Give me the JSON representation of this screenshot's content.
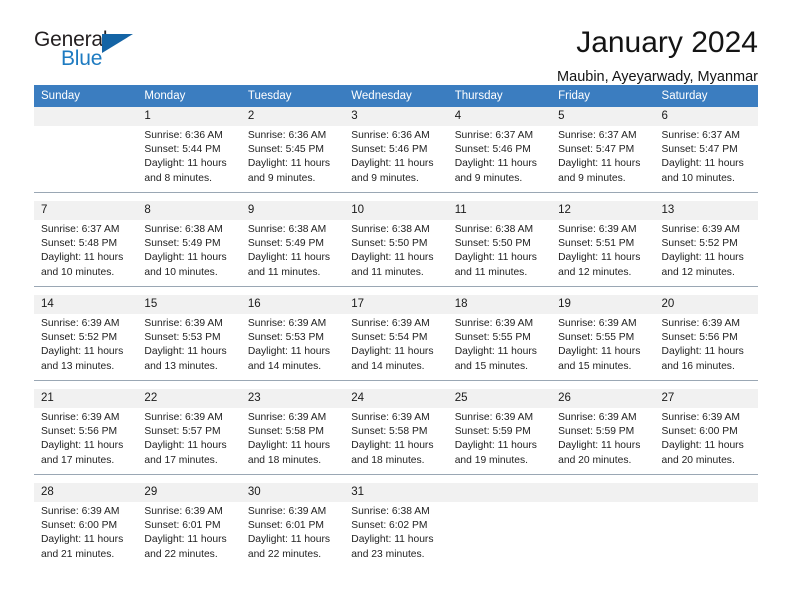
{
  "logo": {
    "word_one": "General",
    "word_two": "Blue",
    "mark": "triangle-icon"
  },
  "header": {
    "title": "January 2024",
    "location": "Maubin, Ayeyarwady, Myanmar"
  },
  "theme": {
    "header_blue": "#3b7dc0",
    "daynum_gray": "#f1f1f1",
    "separator": "#9aa7b4",
    "logo_blue": "#1e7bc1"
  },
  "calendar": {
    "weekday_headers": [
      "Sunday",
      "Monday",
      "Tuesday",
      "Wednesday",
      "Thursday",
      "Friday",
      "Saturday"
    ],
    "weeks": [
      [
        {
          "day": "",
          "sunrise": "",
          "sunset": "",
          "daylight_line1": "",
          "daylight_line2": ""
        },
        {
          "day": "1",
          "sunrise": "Sunrise: 6:36 AM",
          "sunset": "Sunset: 5:44 PM",
          "daylight_line1": "Daylight: 11 hours",
          "daylight_line2": "and 8 minutes."
        },
        {
          "day": "2",
          "sunrise": "Sunrise: 6:36 AM",
          "sunset": "Sunset: 5:45 PM",
          "daylight_line1": "Daylight: 11 hours",
          "daylight_line2": "and 9 minutes."
        },
        {
          "day": "3",
          "sunrise": "Sunrise: 6:36 AM",
          "sunset": "Sunset: 5:46 PM",
          "daylight_line1": "Daylight: 11 hours",
          "daylight_line2": "and 9 minutes."
        },
        {
          "day": "4",
          "sunrise": "Sunrise: 6:37 AM",
          "sunset": "Sunset: 5:46 PM",
          "daylight_line1": "Daylight: 11 hours",
          "daylight_line2": "and 9 minutes."
        },
        {
          "day": "5",
          "sunrise": "Sunrise: 6:37 AM",
          "sunset": "Sunset: 5:47 PM",
          "daylight_line1": "Daylight: 11 hours",
          "daylight_line2": "and 9 minutes."
        },
        {
          "day": "6",
          "sunrise": "Sunrise: 6:37 AM",
          "sunset": "Sunset: 5:47 PM",
          "daylight_line1": "Daylight: 11 hours",
          "daylight_line2": "and 10 minutes."
        }
      ],
      [
        {
          "day": "7",
          "sunrise": "Sunrise: 6:37 AM",
          "sunset": "Sunset: 5:48 PM",
          "daylight_line1": "Daylight: 11 hours",
          "daylight_line2": "and 10 minutes."
        },
        {
          "day": "8",
          "sunrise": "Sunrise: 6:38 AM",
          "sunset": "Sunset: 5:49 PM",
          "daylight_line1": "Daylight: 11 hours",
          "daylight_line2": "and 10 minutes."
        },
        {
          "day": "9",
          "sunrise": "Sunrise: 6:38 AM",
          "sunset": "Sunset: 5:49 PM",
          "daylight_line1": "Daylight: 11 hours",
          "daylight_line2": "and 11 minutes."
        },
        {
          "day": "10",
          "sunrise": "Sunrise: 6:38 AM",
          "sunset": "Sunset: 5:50 PM",
          "daylight_line1": "Daylight: 11 hours",
          "daylight_line2": "and 11 minutes."
        },
        {
          "day": "11",
          "sunrise": "Sunrise: 6:38 AM",
          "sunset": "Sunset: 5:50 PM",
          "daylight_line1": "Daylight: 11 hours",
          "daylight_line2": "and 11 minutes."
        },
        {
          "day": "12",
          "sunrise": "Sunrise: 6:39 AM",
          "sunset": "Sunset: 5:51 PM",
          "daylight_line1": "Daylight: 11 hours",
          "daylight_line2": "and 12 minutes."
        },
        {
          "day": "13",
          "sunrise": "Sunrise: 6:39 AM",
          "sunset": "Sunset: 5:52 PM",
          "daylight_line1": "Daylight: 11 hours",
          "daylight_line2": "and 12 minutes."
        }
      ],
      [
        {
          "day": "14",
          "sunrise": "Sunrise: 6:39 AM",
          "sunset": "Sunset: 5:52 PM",
          "daylight_line1": "Daylight: 11 hours",
          "daylight_line2": "and 13 minutes."
        },
        {
          "day": "15",
          "sunrise": "Sunrise: 6:39 AM",
          "sunset": "Sunset: 5:53 PM",
          "daylight_line1": "Daylight: 11 hours",
          "daylight_line2": "and 13 minutes."
        },
        {
          "day": "16",
          "sunrise": "Sunrise: 6:39 AM",
          "sunset": "Sunset: 5:53 PM",
          "daylight_line1": "Daylight: 11 hours",
          "daylight_line2": "and 14 minutes."
        },
        {
          "day": "17",
          "sunrise": "Sunrise: 6:39 AM",
          "sunset": "Sunset: 5:54 PM",
          "daylight_line1": "Daylight: 11 hours",
          "daylight_line2": "and 14 minutes."
        },
        {
          "day": "18",
          "sunrise": "Sunrise: 6:39 AM",
          "sunset": "Sunset: 5:55 PM",
          "daylight_line1": "Daylight: 11 hours",
          "daylight_line2": "and 15 minutes."
        },
        {
          "day": "19",
          "sunrise": "Sunrise: 6:39 AM",
          "sunset": "Sunset: 5:55 PM",
          "daylight_line1": "Daylight: 11 hours",
          "daylight_line2": "and 15 minutes."
        },
        {
          "day": "20",
          "sunrise": "Sunrise: 6:39 AM",
          "sunset": "Sunset: 5:56 PM",
          "daylight_line1": "Daylight: 11 hours",
          "daylight_line2": "and 16 minutes."
        }
      ],
      [
        {
          "day": "21",
          "sunrise": "Sunrise: 6:39 AM",
          "sunset": "Sunset: 5:56 PM",
          "daylight_line1": "Daylight: 11 hours",
          "daylight_line2": "and 17 minutes."
        },
        {
          "day": "22",
          "sunrise": "Sunrise: 6:39 AM",
          "sunset": "Sunset: 5:57 PM",
          "daylight_line1": "Daylight: 11 hours",
          "daylight_line2": "and 17 minutes."
        },
        {
          "day": "23",
          "sunrise": "Sunrise: 6:39 AM",
          "sunset": "Sunset: 5:58 PM",
          "daylight_line1": "Daylight: 11 hours",
          "daylight_line2": "and 18 minutes."
        },
        {
          "day": "24",
          "sunrise": "Sunrise: 6:39 AM",
          "sunset": "Sunset: 5:58 PM",
          "daylight_line1": "Daylight: 11 hours",
          "daylight_line2": "and 18 minutes."
        },
        {
          "day": "25",
          "sunrise": "Sunrise: 6:39 AM",
          "sunset": "Sunset: 5:59 PM",
          "daylight_line1": "Daylight: 11 hours",
          "daylight_line2": "and 19 minutes."
        },
        {
          "day": "26",
          "sunrise": "Sunrise: 6:39 AM",
          "sunset": "Sunset: 5:59 PM",
          "daylight_line1": "Daylight: 11 hours",
          "daylight_line2": "and 20 minutes."
        },
        {
          "day": "27",
          "sunrise": "Sunrise: 6:39 AM",
          "sunset": "Sunset: 6:00 PM",
          "daylight_line1": "Daylight: 11 hours",
          "daylight_line2": "and 20 minutes."
        }
      ],
      [
        {
          "day": "28",
          "sunrise": "Sunrise: 6:39 AM",
          "sunset": "Sunset: 6:00 PM",
          "daylight_line1": "Daylight: 11 hours",
          "daylight_line2": "and 21 minutes."
        },
        {
          "day": "29",
          "sunrise": "Sunrise: 6:39 AM",
          "sunset": "Sunset: 6:01 PM",
          "daylight_line1": "Daylight: 11 hours",
          "daylight_line2": "and 22 minutes."
        },
        {
          "day": "30",
          "sunrise": "Sunrise: 6:39 AM",
          "sunset": "Sunset: 6:01 PM",
          "daylight_line1": "Daylight: 11 hours",
          "daylight_line2": "and 22 minutes."
        },
        {
          "day": "31",
          "sunrise": "Sunrise: 6:38 AM",
          "sunset": "Sunset: 6:02 PM",
          "daylight_line1": "Daylight: 11 hours",
          "daylight_line2": "and 23 minutes."
        },
        {
          "day": "",
          "sunrise": "",
          "sunset": "",
          "daylight_line1": "",
          "daylight_line2": ""
        },
        {
          "day": "",
          "sunrise": "",
          "sunset": "",
          "daylight_line1": "",
          "daylight_line2": ""
        },
        {
          "day": "",
          "sunrise": "",
          "sunset": "",
          "daylight_line1": "",
          "daylight_line2": ""
        }
      ]
    ]
  }
}
